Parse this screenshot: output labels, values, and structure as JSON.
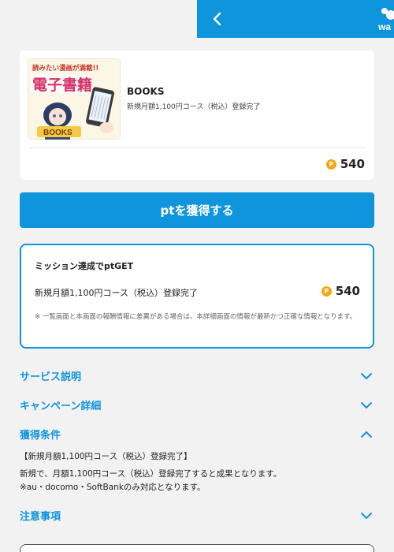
{
  "header": {
    "logo_text": "wa"
  },
  "offer": {
    "title": "BOOKS",
    "subtitle": "新規月額1,100円コース（税込）登録完了",
    "thumbnail": {
      "banner": "読みたい漫画が満載!!",
      "big": "電子書籍",
      "label": "BOOKS"
    },
    "coin": "P",
    "points": "540"
  },
  "cta": {
    "label": "ptを獲得する"
  },
  "mission": {
    "heading": "ミッション達成でptGET",
    "item_label": "新規月額1,100円コース（税込）登録完了",
    "coin": "P",
    "points": "540",
    "note": "※ 一覧画面と本画面の報酬情報に差異がある場合は、本詳細画面の情報が最新かつ正確な情報となります。"
  },
  "sections": {
    "service": "サービス説明",
    "campaign": "キャンペーン詳細",
    "conditions": "獲得条件",
    "notes": "注意事項"
  },
  "conditions": {
    "line1": "【新規月額1,100円コース（税込）登録完了】",
    "line2": "新規で、月額1,100円コース（税込）登録完了すると成果となります。",
    "line3": "※au・docomo・SoftBankのみ対応となります。"
  },
  "colors": {
    "accent": "#0f95dc",
    "coin": "#f3a712",
    "background": "#f2f2f2"
  },
  "icons": {
    "back": "chevron-left-icon",
    "expand": "chevron-down-icon",
    "collapse": "chevron-up-icon",
    "coin": "point-coin-icon"
  }
}
